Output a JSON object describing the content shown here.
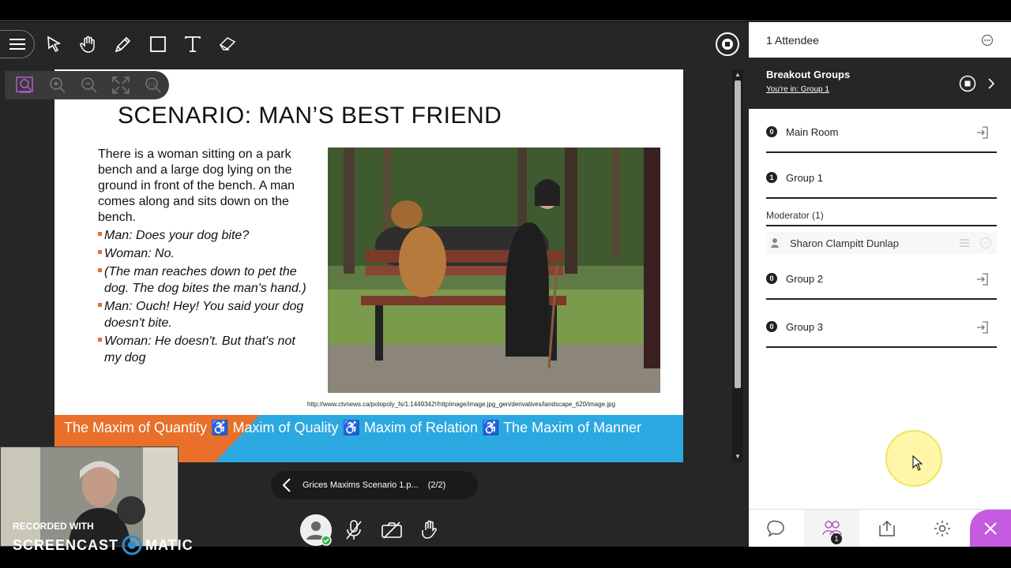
{
  "slide": {
    "title": "SCENARIO: MAN’S BEST FRIEND",
    "intro": "There is a woman sitting on a park bench and a large dog lying on the ground in front of the bench. A man comes along and sits down on the bench.",
    "bullets": [
      "Man: Does your dog bite?",
      "Woman: No.",
      "(The man reaches down to pet the dog. The dog bites the man's hand.)",
      "Man: Ouch! Hey! You said your dog doesn't bite.",
      "Woman: He doesn't. But that's not my dog"
    ],
    "source_url": "http://www.ctvnews.ca/polopoly_fs/1.1449342!/httpImage/image.jpg_gen/derivatives/landscape_620/image.jpg",
    "banner": "The Maxim of Quantity ♿ Maxim of Quality ♿ Maxim of Relation ♿ The Maxim of Manner",
    "accent_orange": "#e8702a",
    "accent_blue": "#2ba8e0"
  },
  "toolbar": {
    "tools": [
      "menu-icon",
      "select-pointer-icon",
      "pan-hand-icon",
      "pencil-icon",
      "rectangle-icon",
      "text-icon",
      "eraser-icon"
    ],
    "zoom": [
      "search-zoom-icon",
      "zoom-in-icon",
      "zoom-out-icon",
      "fit-screen-icon",
      "actual-size-icon"
    ],
    "zoom_actual_label": "1:1"
  },
  "pager": {
    "file": "Grices Maxims Scenario 1.p...",
    "page": "(2/2)"
  },
  "watermark": {
    "line1": "RECORDED WITH",
    "line2a": "SCREENCAST",
    "line2b": "MATIC"
  },
  "panel": {
    "attendees": "1 Attendee",
    "breakout_title": "Breakout Groups",
    "breakout_sub": "You're in: Group 1",
    "groups": [
      {
        "count": "0",
        "name": "Main Room"
      },
      {
        "count": "1",
        "name": "Group 1"
      },
      {
        "count": "0",
        "name": "Group 2"
      },
      {
        "count": "0",
        "name": "Group 3"
      }
    ],
    "moderator_label": "Moderator (1)",
    "moderator_name": "Sharon Clampitt Dunlap",
    "nav_badge": "1",
    "close_color": "#c55ce0"
  }
}
